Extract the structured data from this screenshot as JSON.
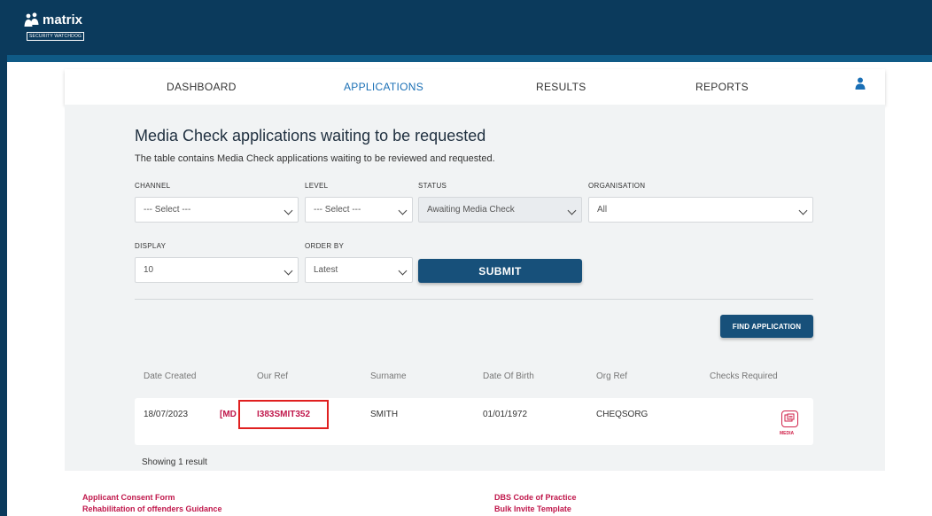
{
  "brand": {
    "name": "matrix",
    "tagline": "SECURITY WATCHDOG"
  },
  "nav": {
    "items": [
      {
        "label": "DASHBOARD"
      },
      {
        "label": "APPLICATIONS"
      },
      {
        "label": "RESULTS"
      },
      {
        "label": "REPORTS"
      }
    ],
    "active": "APPLICATIONS"
  },
  "page": {
    "title": "Media Check applications waiting to be requested",
    "subtitle": "The table contains Media Check applications waiting to be reviewed and requested."
  },
  "filters": {
    "channel": {
      "label": "CHANNEL",
      "value": "--- Select ---"
    },
    "level": {
      "label": "LEVEL",
      "value": "--- Select ---"
    },
    "status": {
      "label": "STATUS",
      "value": "Awaiting Media Check"
    },
    "organisation": {
      "label": "ORGANISATION",
      "value": "All"
    },
    "display": {
      "label": "DISPLAY",
      "value": "10"
    },
    "order_by": {
      "label": "ORDER BY",
      "value": "Latest"
    },
    "submit_label": "SUBMIT"
  },
  "find_label": "FIND APPLICATION",
  "table": {
    "columns": [
      "Date Created",
      "Our Ref",
      "Surname",
      "Date Of Birth",
      "Org Ref",
      "Checks Required"
    ],
    "rows": [
      {
        "date_created": "18/07/2023",
        "prefix": "[MD",
        "our_ref": "I383SMIT352",
        "surname": "SMITH",
        "dob": "01/01/1972",
        "org_ref": "CHEQSORG",
        "check_label": "MEDIA"
      }
    ],
    "summary": "Showing 1 result"
  },
  "footer": {
    "links": [
      "Applicant Consent Form",
      "Rehabilitation of offenders Guidance",
      "DBS Code of Practice",
      "Bulk Invite Template"
    ]
  },
  "colors": {
    "header": "#0b3a5c",
    "button": "#17507a",
    "link": "#c0174b",
    "highlight": "#e02020"
  }
}
